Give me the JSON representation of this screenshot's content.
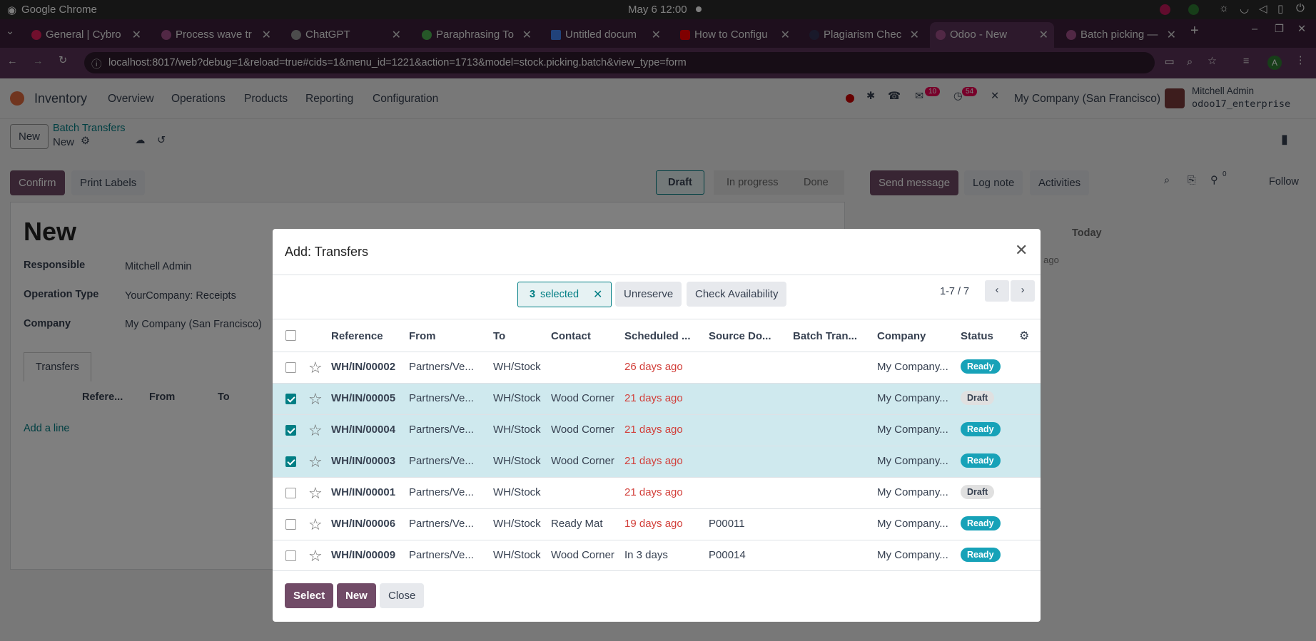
{
  "os": {
    "app": "Google Chrome",
    "clock": "May 6  12:00"
  },
  "tabs": [
    {
      "label": "General | Cybro",
      "color": "#e01e5a"
    },
    {
      "label": "Process wave tr",
      "color": "#a27"
    },
    {
      "label": "ChatGPT",
      "color": "#888"
    },
    {
      "label": "Paraphrasing To",
      "color": "#4caf50"
    },
    {
      "label": "Untitled docum",
      "color": "#4285f4"
    },
    {
      "label": "How to Configu",
      "color": "#f00"
    },
    {
      "label": "Plagiarism Chec",
      "color": "#335"
    },
    {
      "label": "Odoo - New",
      "color": "#a27"
    },
    {
      "label": "Batch picking —",
      "color": "#a27"
    }
  ],
  "address": {
    "url": "localhost:8017/web?debug=1&reload=true#cids=1&menu_id=1221&action=1713&model=stock.picking.batch&view_type=form"
  },
  "nav": {
    "app": "Inventory",
    "menus": [
      "Overview",
      "Operations",
      "Products",
      "Reporting",
      "Configuration"
    ],
    "chat_badge": "10",
    "activity_badge": "54",
    "company": "My Company (San Francisco)",
    "user": "Mitchell Admin",
    "db": "odoo17_enterprise"
  },
  "control": {
    "new_label": "New",
    "breadcrumb": "Batch Transfers",
    "record": "New"
  },
  "actions": {
    "confirm": "Confirm",
    "print": "Print Labels"
  },
  "status_steps": [
    "Draft",
    "In progress",
    "Done"
  ],
  "chatter": {
    "send": "Send message",
    "log": "Log note",
    "activities": "Activities",
    "follow": "Follow",
    "today": "Today",
    "ago": "s ago",
    "followers": "0"
  },
  "form": {
    "title": "New",
    "responsible_label": "Responsible",
    "responsible": "Mitchell Admin",
    "optype_label": "Operation Type",
    "optype": "YourCompany: Receipts",
    "company_label": "Company",
    "company": "My Company (San Francisco)",
    "tab": "Transfers",
    "cols": [
      "Refere...",
      "From",
      "To"
    ],
    "add_line": "Add a line"
  },
  "modal": {
    "title": "Add: Transfers",
    "selected_count": "3",
    "selected_text": "selected",
    "unreserve": "Unreserve",
    "check": "Check Availability",
    "pager": "1-7 / 7",
    "headers": [
      "Reference",
      "From",
      "To",
      "Contact",
      "Scheduled ...",
      "Source Do...",
      "Batch Tran...",
      "Company",
      "Status"
    ],
    "rows": [
      {
        "ref": "WH/IN/00002",
        "from": "Partners/Ve...",
        "to": "WH/Stock",
        "contact": "",
        "sched": "26 days ago",
        "late": true,
        "src": "",
        "company": "My Company...",
        "status": "Ready",
        "checked": false
      },
      {
        "ref": "WH/IN/00005",
        "from": "Partners/Ve...",
        "to": "WH/Stock",
        "contact": "Wood Corner",
        "sched": "21 days ago",
        "late": true,
        "src": "",
        "company": "My Company...",
        "status": "Draft",
        "checked": true
      },
      {
        "ref": "WH/IN/00004",
        "from": "Partners/Ve...",
        "to": "WH/Stock",
        "contact": "Wood Corner",
        "sched": "21 days ago",
        "late": true,
        "src": "",
        "company": "My Company...",
        "status": "Ready",
        "checked": true
      },
      {
        "ref": "WH/IN/00003",
        "from": "Partners/Ve...",
        "to": "WH/Stock",
        "contact": "Wood Corner",
        "sched": "21 days ago",
        "late": true,
        "src": "",
        "company": "My Company...",
        "status": "Ready",
        "checked": true
      },
      {
        "ref": "WH/IN/00001",
        "from": "Partners/Ve...",
        "to": "WH/Stock",
        "contact": "",
        "sched": "21 days ago",
        "late": true,
        "src": "",
        "company": "My Company...",
        "status": "Draft",
        "checked": false
      },
      {
        "ref": "WH/IN/00006",
        "from": "Partners/Ve...",
        "to": "WH/Stock",
        "contact": "Ready Mat",
        "sched": "19 days ago",
        "late": true,
        "src": "P00011",
        "company": "My Company...",
        "status": "Ready",
        "checked": false
      },
      {
        "ref": "WH/IN/00009",
        "from": "Partners/Ve...",
        "to": "WH/Stock",
        "contact": "Wood Corner",
        "sched": "In 3 days",
        "late": false,
        "src": "P00014",
        "company": "My Company...",
        "status": "Ready",
        "checked": false
      }
    ],
    "select": "Select",
    "new": "New",
    "close": "Close"
  }
}
